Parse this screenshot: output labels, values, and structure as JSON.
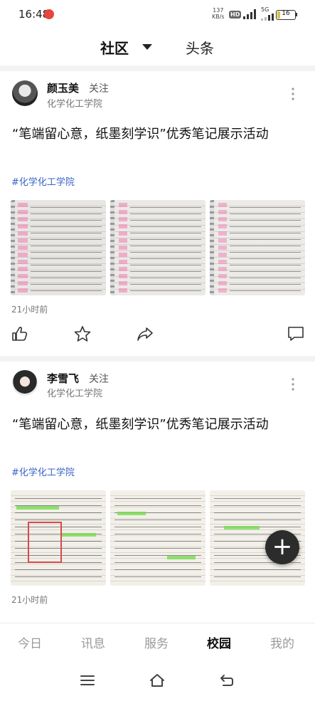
{
  "status_bar": {
    "time": "16:48",
    "net_speed_value": "137",
    "net_speed_unit": "KB/s",
    "hd_label": "HD",
    "network_label": "5G",
    "battery_level": "16"
  },
  "top_nav": {
    "community": "社区",
    "headline": "头条"
  },
  "posts": [
    {
      "author": "颜玉美",
      "follow": "关注",
      "college": "化学化工学院",
      "title": "“笔端留心意，纸墨刻学识”优秀笔记展示活动",
      "hashtag": "#化学化工学院",
      "time": "21小时前"
    },
    {
      "author": "李雪飞",
      "follow": "关注",
      "college": "化学化工学院",
      "title": "“笔端留心意，纸墨刻学识”优秀笔记展示活动",
      "hashtag": "#化学化工学院",
      "time": "21小时前"
    }
  ],
  "fab_label": "+",
  "bottom_tabs": [
    {
      "label": "今日"
    },
    {
      "label": "讯息"
    },
    {
      "label": "服务"
    },
    {
      "label": "校园"
    },
    {
      "label": "我的"
    }
  ],
  "colors": {
    "accent": "#3a64c8",
    "highlight_pink": "#f07bb0",
    "battery": "#d9c23a"
  },
  "icons": [
    "like-icon",
    "favorite-star-icon",
    "share-icon",
    "comment-icon",
    "more-vertical-icon",
    "add-icon",
    "menu-icon",
    "home-icon",
    "back-icon"
  ]
}
